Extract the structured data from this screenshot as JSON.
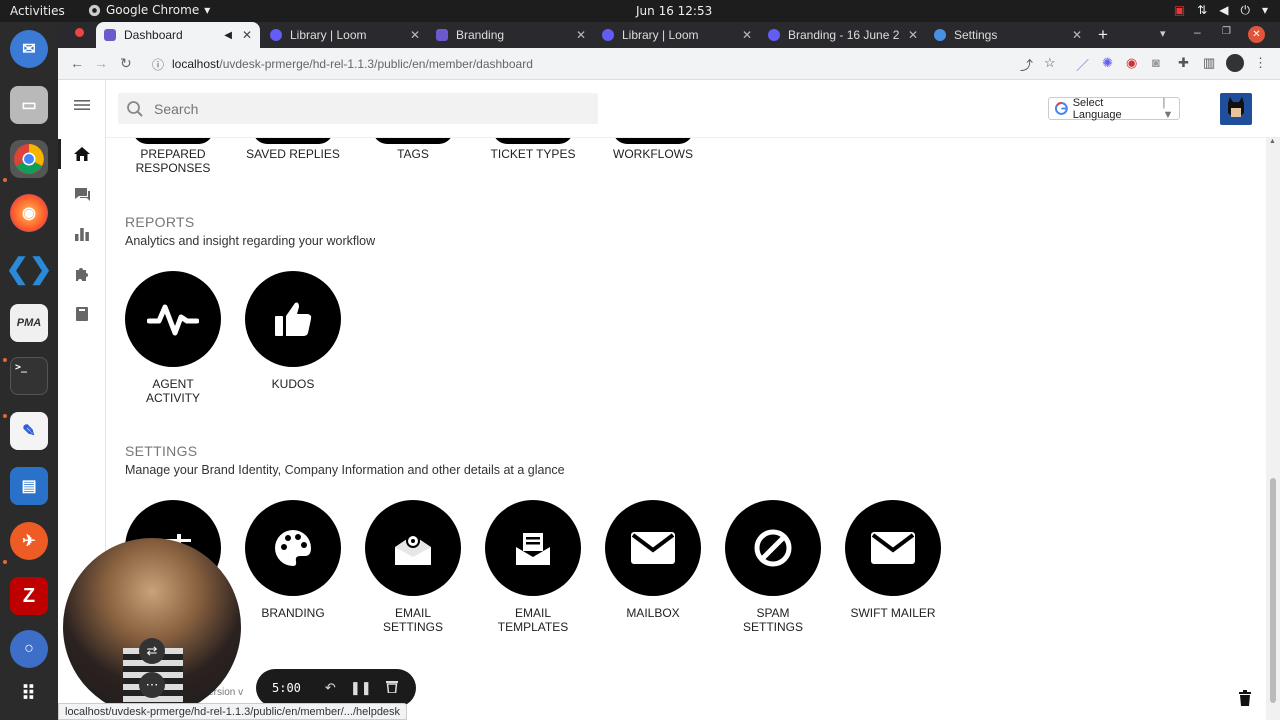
{
  "system": {
    "activities": "Activities",
    "app_name": "Google Chrome",
    "clock": "Jun 16  12:53"
  },
  "tabs": [
    {
      "label": "Dashboard",
      "active": true
    },
    {
      "label": "Library | Loom"
    },
    {
      "label": "Branding"
    },
    {
      "label": "Library | Loom"
    },
    {
      "label": "Branding - 16 June 2"
    },
    {
      "label": "Settings"
    }
  ],
  "address": {
    "host": "localhost",
    "path": "/uvdesk-prmerge/hd-rel-1.1.3/public/en/member/dashboard"
  },
  "header": {
    "search_placeholder": "Search",
    "language": "Select Language"
  },
  "top_row": [
    {
      "label": "PREPARED RESPONSES"
    },
    {
      "label": "SAVED REPLIES"
    },
    {
      "label": "TAGS"
    },
    {
      "label": "TICKET TYPES"
    },
    {
      "label": "WORKFLOWS"
    }
  ],
  "reports": {
    "title": "REPORTS",
    "description": "Analytics and insight regarding your workflow",
    "items": [
      {
        "label": "AGENT ACTIVITY",
        "icon": "activity-icon"
      },
      {
        "label": "KUDOS",
        "icon": "thumbs-up-icon"
      }
    ]
  },
  "settings": {
    "title": "SETTINGS",
    "description": "Manage your Brand Identity, Company Information and other details at a glance",
    "items": [
      {
        "label": "",
        "icon": "sliders-icon"
      },
      {
        "label": "BRANDING",
        "icon": "palette-icon"
      },
      {
        "label": "EMAIL SETTINGS",
        "icon": "email-gear-icon"
      },
      {
        "label": "EMAIL TEMPLATES",
        "icon": "email-template-icon"
      },
      {
        "label": "MAILBOX",
        "icon": "envelope-icon"
      },
      {
        "label": "SPAM SETTINGS",
        "icon": "block-icon"
      },
      {
        "label": "SWIFT MAILER",
        "icon": "envelope-icon"
      }
    ]
  },
  "loom": {
    "time": "5:00"
  },
  "status_url": "localhost/uvdesk-prmerge/hd-rel-1.1.3/public/en/member/.../helpdesk",
  "footer_version": "Version v"
}
